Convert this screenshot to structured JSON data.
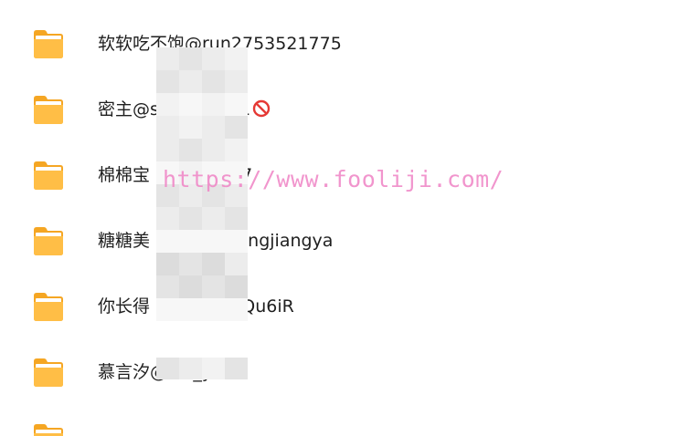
{
  "folders": [
    {
      "name": "软软吃不饱@run2753521775",
      "badge": ""
    },
    {
      "name": "密主@s        11",
      "badge": "no-entry-icon"
    },
    {
      "name": "棉棉宝        187",
      "badge": ""
    },
    {
      "name": "糖糖美        gtangjiangya",
      "badge": ""
    },
    {
      "name": "你长得        l@Qu6iR",
      "badge": ""
    },
    {
      "name": "慕言汐@Mu_yanxi",
      "badge": ""
    }
  ],
  "watermark": "https://www.fooliji.com/",
  "colors": {
    "folder_body": "#FFBE46",
    "folder_back": "#F5A623",
    "folder_paper": "#FFFFFF",
    "text": "#1F1F1F",
    "watermark": "#F08AC8",
    "no_entry": "#E53935"
  },
  "icons": {
    "folder": "folder-icon",
    "badge": "no-entry-icon"
  }
}
